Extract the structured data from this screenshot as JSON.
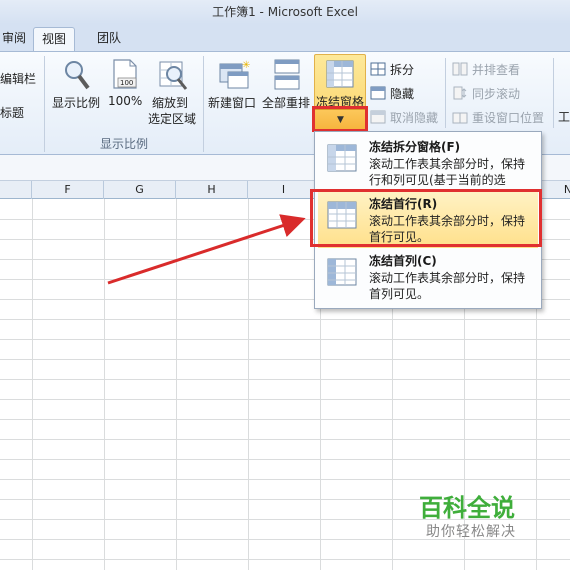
{
  "window": {
    "title": "工作簿1 - Microsoft Excel"
  },
  "tabs": [
    {
      "label": "审阅"
    },
    {
      "label": "视图"
    },
    {
      "label": "团队"
    }
  ],
  "ribbon": {
    "left_partial": {
      "edit_bar": "编辑栏",
      "headings": "标题"
    },
    "zoom_group": {
      "label": "显示比例",
      "zoom": "显示比例",
      "hundred": "100%",
      "zoom_to_sel_line1": "缩放到",
      "zoom_to_sel_line2": "选定区域"
    },
    "window_group": {
      "new_window": "新建窗口",
      "arrange_all": "全部重排",
      "freeze_panes": "冻结窗格",
      "split": "拆分",
      "hide": "隐藏",
      "unhide": "取消隐藏",
      "side_by_side": "并排查看",
      "sync_scroll": "同步滚动",
      "reset_pos": "重设窗口位置",
      "switch_partial": "工"
    }
  },
  "columns": [
    "F",
    "G",
    "H",
    "I",
    "N"
  ],
  "freeze_menu": [
    {
      "title": "冻结拆分窗格(F)",
      "desc": "滚动工作表其余部分时，保持行和列可见(基于当前的选择)。",
      "highlighted": false
    },
    {
      "title": "冻结首行(R)",
      "desc": "滚动工作表其余部分时，保持首行可见。",
      "highlighted": true
    },
    {
      "title": "冻结首列(C)",
      "desc": "滚动工作表其余部分时，保持首列可见。",
      "highlighted": false
    }
  ],
  "watermark": {
    "title": "百科全说",
    "subtitle": "助你轻松解决"
  },
  "colors": {
    "highlight": "#ffe08a",
    "annotation": "#e03030",
    "watermark": "#3fae3b"
  }
}
